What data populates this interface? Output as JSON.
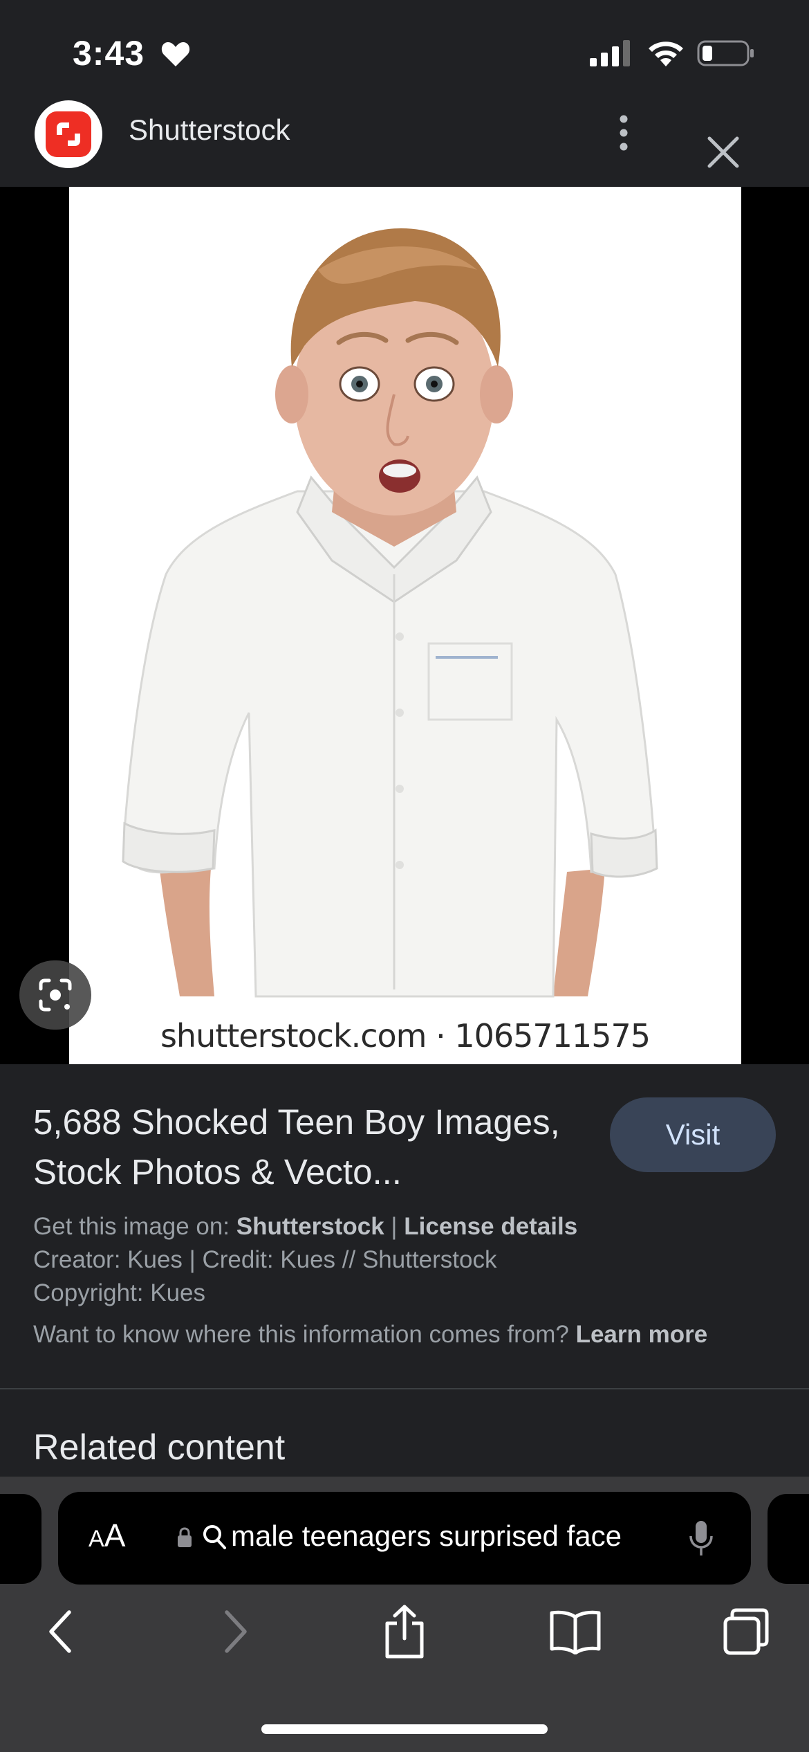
{
  "status_bar": {
    "time": "3:43",
    "icons": [
      "heart-icon",
      "cellular-signal-icon",
      "wifi-icon",
      "battery-icon"
    ]
  },
  "header": {
    "site_name": "Shutterstock",
    "logo_icon": "shutterstock-logo",
    "menu_icon": "more-vert-icon",
    "close_icon": "close-icon"
  },
  "image": {
    "watermark": "shutterstock.com · 1065711575",
    "lens_icon": "google-lens-icon"
  },
  "result": {
    "title": "5,688 Shocked Teen Boy Images, Stock Photos & Vecto...",
    "visit_label": "Visit",
    "get_image_prefix": "Get this image on: ",
    "source_link": "Shutterstock",
    "separator": " | ",
    "license_link": "License details",
    "creator_line": "Creator: Kues | Credit: Kues // Shutterstock",
    "copyright_line": "Copyright: Kues",
    "info_prompt": "Want to know where this information comes from? ",
    "learn_more": "Learn more"
  },
  "related": {
    "title": "Related content"
  },
  "browser": {
    "aa_small": "A",
    "aa_large": "A",
    "url": "male teenagers surprised face",
    "icons": [
      "lock-icon",
      "search-icon",
      "microphone-icon",
      "back-icon",
      "forward-icon",
      "share-icon",
      "bookmarks-icon",
      "tabs-icon"
    ]
  },
  "colors": {
    "background": "#202124",
    "visit_button": "#394457",
    "shutterstock_red": "#ee2e24",
    "toolbar": "#3a3a3c"
  }
}
